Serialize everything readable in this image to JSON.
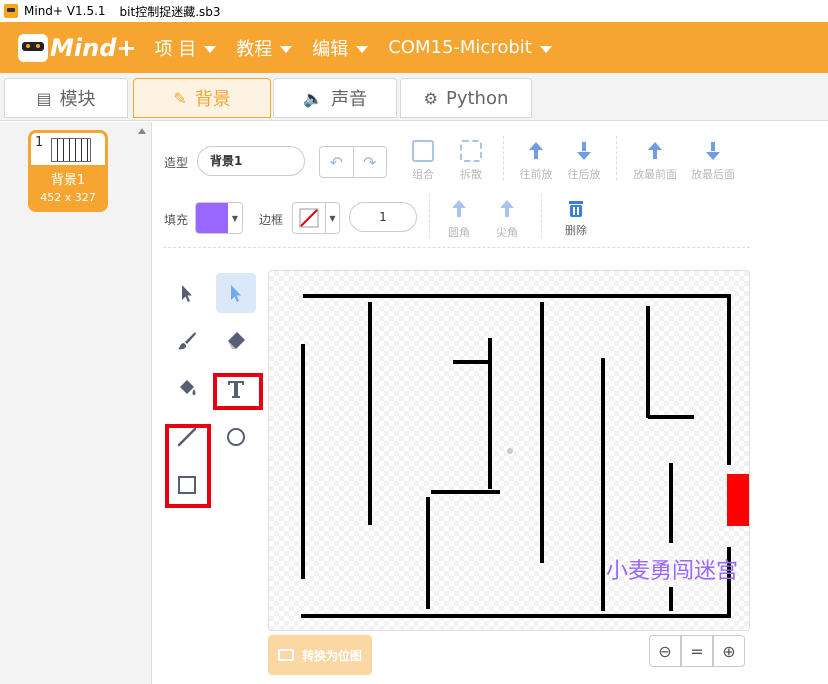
{
  "titlebar": {
    "app": "Mind+ V1.5.1",
    "file": "bit控制捉迷藏.sb3"
  },
  "menubar": {
    "logo": "Mind+",
    "items": [
      {
        "label": "项 目"
      },
      {
        "label": "教程"
      },
      {
        "label": "编辑"
      },
      {
        "label": "COM15-Microbit"
      }
    ]
  },
  "tabs": [
    {
      "label": "模块",
      "icon": "blocks-icon"
    },
    {
      "label": "背景",
      "icon": "brush-icon",
      "active": true
    },
    {
      "label": "声音",
      "icon": "speaker-icon"
    },
    {
      "label": "Python",
      "icon": "python-icon"
    }
  ],
  "costume_list": [
    {
      "number": "1",
      "name": "背景1",
      "size": "452 x 327"
    }
  ],
  "editor": {
    "costume_label": "造型",
    "costume_name": "背景1",
    "fill_label": "填充",
    "fill_color": "#9966ff",
    "outline_label": "边框",
    "outline_width": "1",
    "toolbar": {
      "group": "组合",
      "ungroup": "拆散",
      "forward": "往前放",
      "backward": "往后放",
      "front": "放最前面",
      "back": "放最后面",
      "round": "圆角",
      "pointed": "尖角",
      "delete": "删除"
    },
    "canvas_text": "小麦勇闯迷宫",
    "convert_button": "转换为位图",
    "zoom_reset": "="
  },
  "colors": {
    "accent": "#f7a531",
    "highlight": "#e60012",
    "goal": "#ff0000"
  }
}
